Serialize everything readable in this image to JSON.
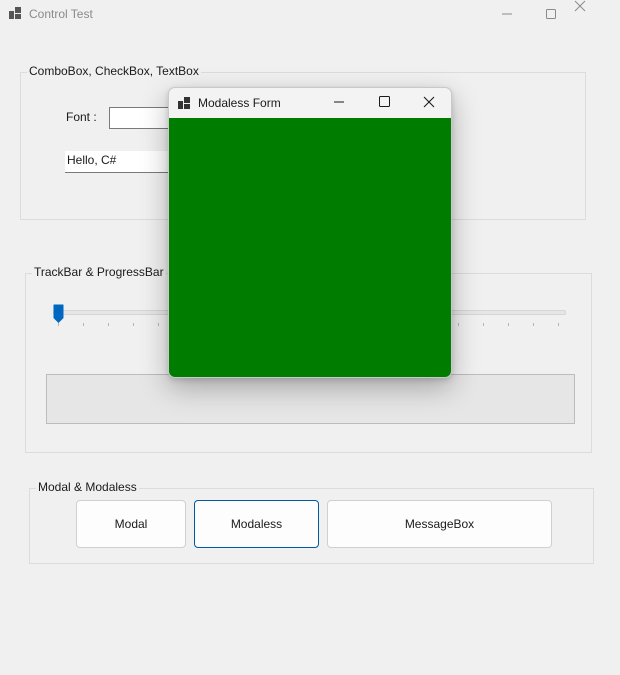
{
  "window": {
    "title": "Control Test"
  },
  "group_combo": {
    "legend": "ComboBox, CheckBox, TextBox",
    "font_label": "Font :",
    "font_value": "",
    "textbox_value": "Hello, C#"
  },
  "group_track": {
    "legend": "TrackBar & ProgressBar",
    "trackbar_value_fraction": 0.0,
    "progress_fraction": 0.0
  },
  "group_modal": {
    "legend": "Modal & Modaless",
    "buttons": [
      "Modal",
      "Modaless",
      "MessageBox"
    ]
  },
  "dialog": {
    "title": "Modaless Form",
    "client_color": "#007c00"
  },
  "colors": {
    "accent": "#0067c0",
    "focus_border": "#005a9e",
    "background": "#f0f0f0"
  },
  "icons": [
    "app-icon",
    "minimize-icon",
    "maximize-icon",
    "close-icon",
    "trackbar-thumb"
  ]
}
